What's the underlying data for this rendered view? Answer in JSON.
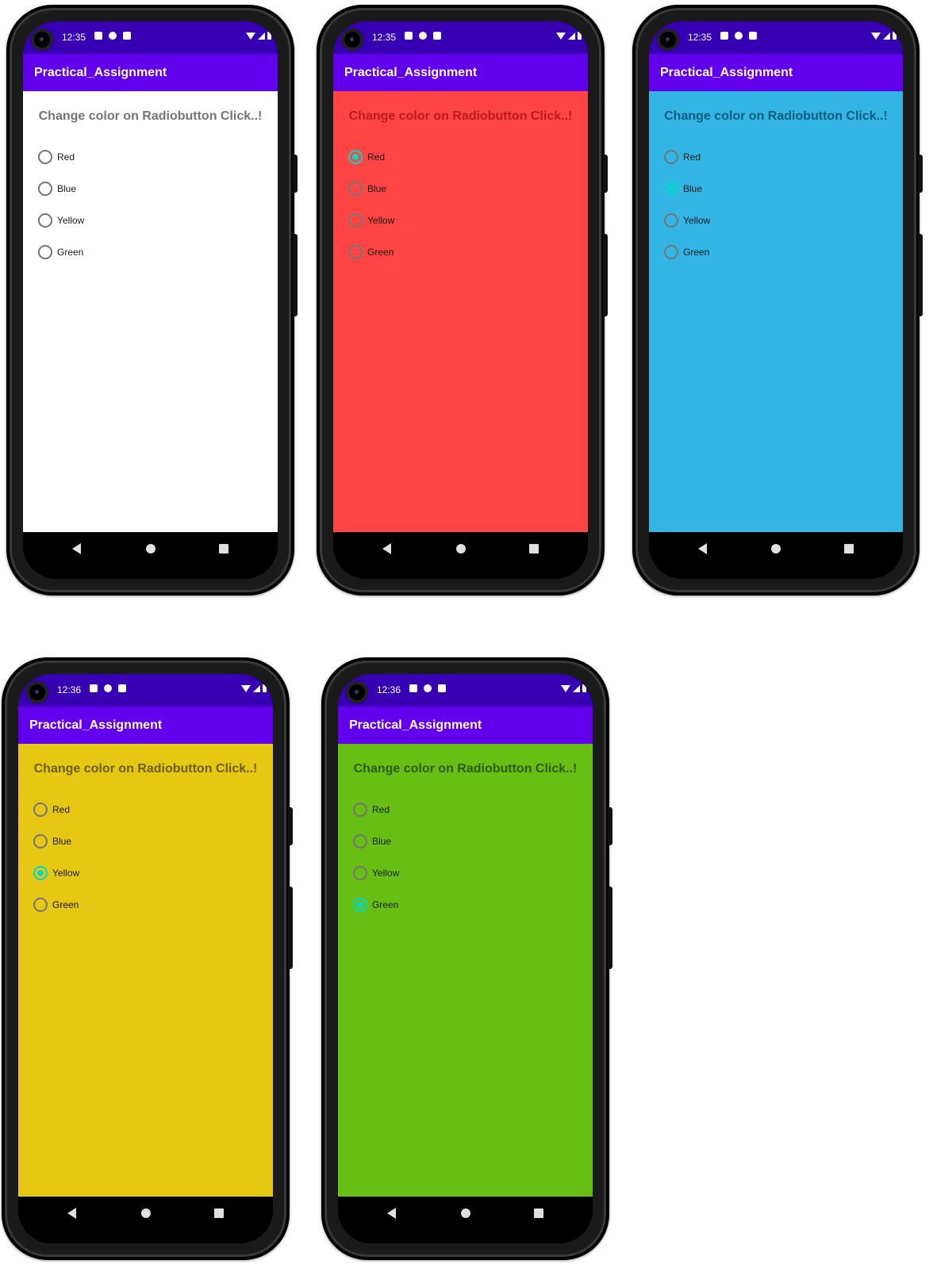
{
  "screens": [
    {
      "time": "12:35",
      "app_title": "Practical_Assignment",
      "heading": "Change color on Radiobutton Click..!",
      "background": "#ffffff",
      "heading_color": "#757575",
      "options": [
        "Red",
        "Blue",
        "Yellow",
        "Green"
      ],
      "selected": null
    },
    {
      "time": "12:35",
      "app_title": "Practical_Assignment",
      "heading": "Change color on Radiobutton Click..!",
      "background": "#ff4444",
      "heading_color": "#b71c1c",
      "options": [
        "Red",
        "Blue",
        "Yellow",
        "Green"
      ],
      "selected": "Red"
    },
    {
      "time": "12:35",
      "app_title": "Practical_Assignment",
      "heading": "Change color on Radiobutton Click..!",
      "background": "#33b5e5",
      "heading_color": "#0d5d7a",
      "options": [
        "Red",
        "Blue",
        "Yellow",
        "Green"
      ],
      "selected": "Blue"
    },
    {
      "time": "12:36",
      "app_title": "Practical_Assignment",
      "heading": "Change color on Radiobutton Click..!",
      "background": "#e6c814",
      "heading_color": "#6b5d0a",
      "options": [
        "Red",
        "Blue",
        "Yellow",
        "Green"
      ],
      "selected": "Yellow"
    },
    {
      "time": "12:36",
      "app_title": "Practical_Assignment",
      "heading": "Change color on Radiobutton Click..!",
      "background": "#66bf12",
      "heading_color": "#2e5a08",
      "options": [
        "Red",
        "Blue",
        "Yellow",
        "Green"
      ],
      "selected": "Green"
    }
  ],
  "colors": {
    "status_bar": "#3700b3",
    "app_bar": "#6200ee",
    "radio_checked": "#03dac5"
  },
  "icons": {
    "status_left": [
      "notification-a-icon",
      "notification-p-icon",
      "sd-card-icon"
    ],
    "status_right": [
      "wifi-icon",
      "signal-icon",
      "battery-icon"
    ],
    "nav": [
      "back-icon",
      "home-icon",
      "recents-icon"
    ]
  }
}
